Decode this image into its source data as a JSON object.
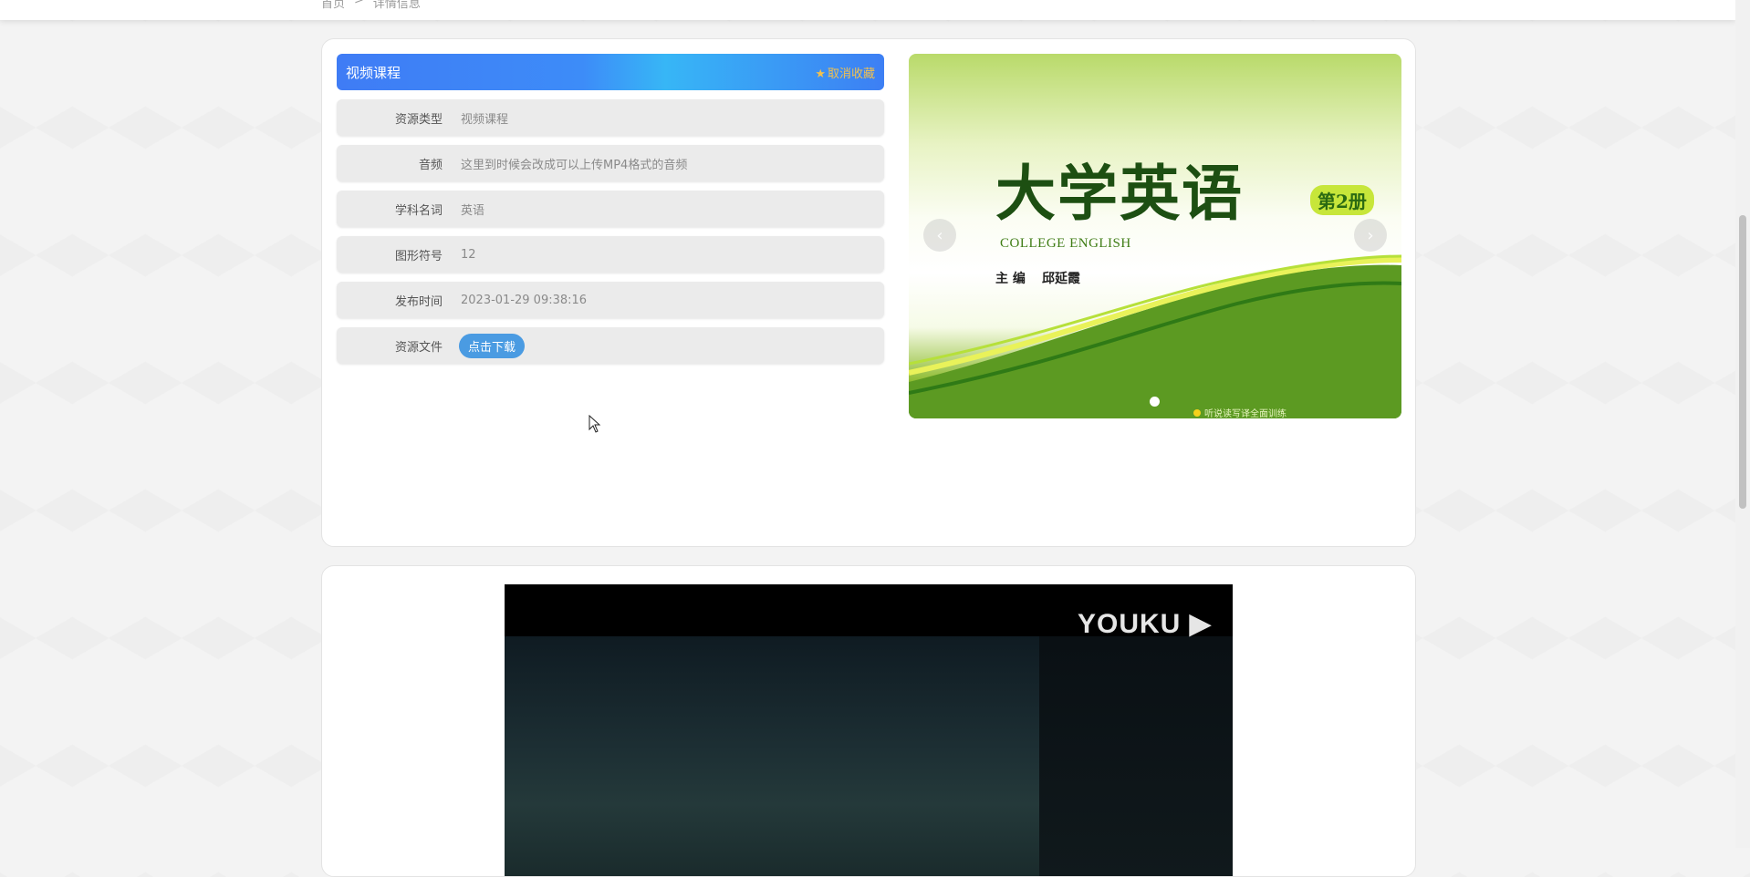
{
  "breadcrumb": {
    "home": "首页",
    "separator": ">",
    "current": "详情信息"
  },
  "detail": {
    "title": "视频课程",
    "favorite_label": "取消收藏",
    "fields": [
      {
        "label": "资源类型",
        "value": "视频课程"
      },
      {
        "label": "音频",
        "value": "这里到时候会改成可以上传MP4格式的音频"
      },
      {
        "label": "学科名词",
        "value": "英语"
      },
      {
        "label": "图形符号",
        "value": "12"
      },
      {
        "label": "发布时间",
        "value": "2023-01-29 09:38:16"
      }
    ],
    "file_label": "资源文件",
    "download_label": "点击下载"
  },
  "carousel": {
    "cover_title": "大学英语",
    "cover_volume": "第2册",
    "cover_en": "COLLEGE ENGLISH",
    "cover_editor_label": "主 编",
    "cover_editor_name": "邱延霞",
    "cover_tagline": "听说读写译全面训练",
    "prev_icon": "chevron-left-icon",
    "next_icon": "chevron-right-icon"
  },
  "video": {
    "logo": "YOUKU"
  },
  "colors": {
    "accent_blue": "#3f7cf5",
    "favorite": "#f2c14e",
    "download_button": "#4a9be2"
  }
}
